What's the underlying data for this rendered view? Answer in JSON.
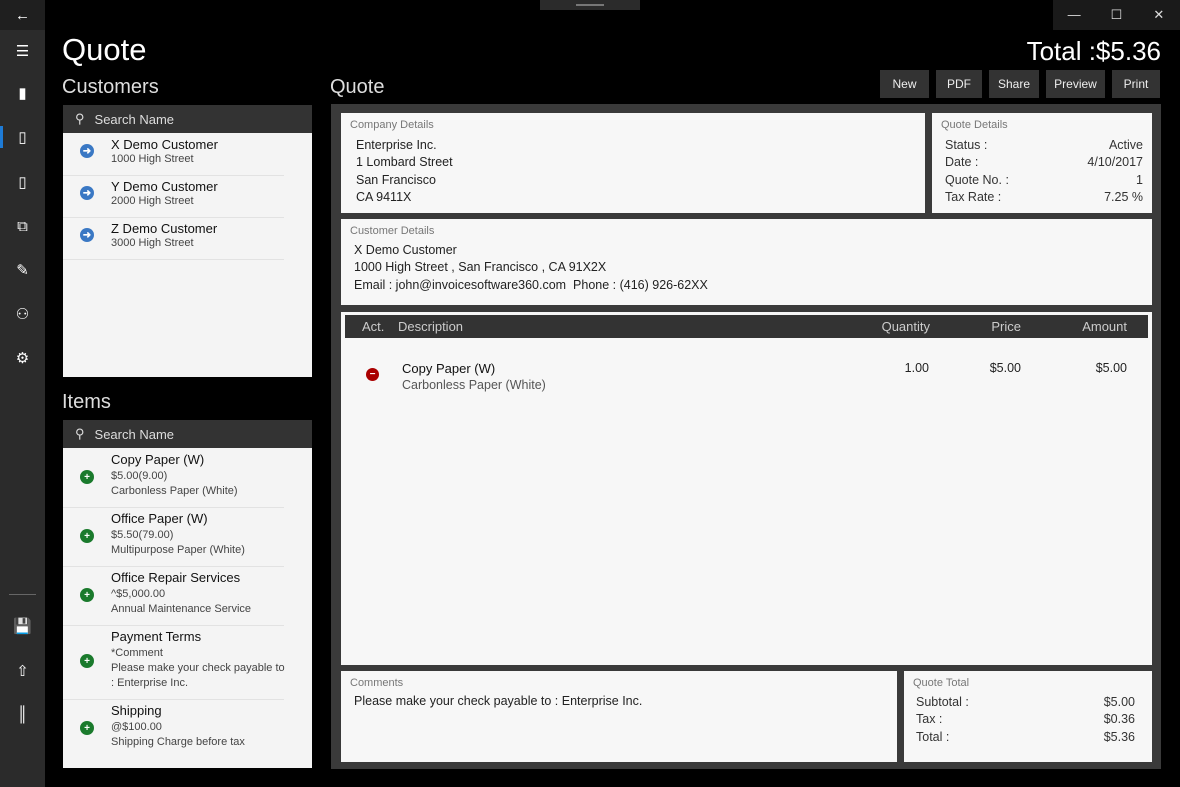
{
  "window": {
    "controls": [
      "minimize",
      "maximize",
      "close"
    ]
  },
  "sidebar": {
    "items": [
      "back",
      "menu",
      "new-document",
      "quote",
      "invoice",
      "copy",
      "edit",
      "customers",
      "settings",
      "save",
      "upload",
      "library"
    ],
    "active": "quote",
    "accent": "#1e7bd6"
  },
  "page": {
    "title": "Quote",
    "total": "Total :$5.36"
  },
  "customers": {
    "heading": "Customers",
    "search_placeholder": "Search Name",
    "list": [
      {
        "name": "X Demo Customer",
        "address": "1000 High Street"
      },
      {
        "name": "Y Demo Customer",
        "address": "2000 High Street"
      },
      {
        "name": "Z Demo Customer",
        "address": "3000 High Street"
      }
    ]
  },
  "items": {
    "heading": "Items",
    "search_placeholder": "Search Name",
    "list": [
      {
        "name": "Copy Paper (W)",
        "price": "$5.00(9.00)",
        "desc": "Carbonless Paper (White)"
      },
      {
        "name": "Office Paper (W)",
        "price": "$5.50(79.00)",
        "desc": "Multipurpose Paper (White)"
      },
      {
        "name": "Office Repair Services",
        "price": "^$5,000.00",
        "desc": "Annual Maintenance Service"
      },
      {
        "name": "Payment Terms",
        "price": "*Comment",
        "desc": "Please make your check payable to : Enterprise Inc."
      },
      {
        "name": "Shipping",
        "price": "@$100.00",
        "desc": "Shipping Charge before tax"
      }
    ]
  },
  "quote": {
    "heading": "Quote",
    "buttons": [
      "New",
      "PDF",
      "Share",
      "Preview",
      "Print"
    ],
    "company": {
      "label": "Company Details",
      "lines": [
        "Enterprise Inc.",
        "1 Lombard Street",
        "San Francisco",
        "CA 9411X"
      ]
    },
    "details": {
      "label": "Quote Details",
      "rows": [
        {
          "k": "Status :",
          "v": "Active"
        },
        {
          "k": "Date :",
          "v": "4/10/2017"
        },
        {
          "k": "Quote No. :",
          "v": "1"
        },
        {
          "k": "Tax Rate :",
          "v": "7.25 %"
        }
      ]
    },
    "customer": {
      "label": "Customer Details",
      "lines": [
        "X Demo Customer",
        "1000 High Street , San Francisco , CA 91X2X",
        "Email : john@invoicesoftware360.com  Phone : (416) 926-62XX"
      ]
    },
    "table": {
      "headers": [
        "Act.",
        "Description",
        "Quantity",
        "Price",
        "Amount"
      ],
      "rows": [
        {
          "name": "Copy Paper (W)",
          "desc": "Carbonless Paper (White)",
          "qty": "1.00",
          "price": "$5.00",
          "amount": "$5.00"
        }
      ]
    },
    "comments": {
      "label": "Comments",
      "text": "Please make your check payable to : Enterprise Inc."
    },
    "totals": {
      "label": "Quote Total",
      "rows": [
        {
          "k": "Subtotal :",
          "v": "$5.00"
        },
        {
          "k": "Tax :",
          "v": "$0.36"
        },
        {
          "k": "Total :",
          "v": "$5.36"
        }
      ]
    }
  }
}
